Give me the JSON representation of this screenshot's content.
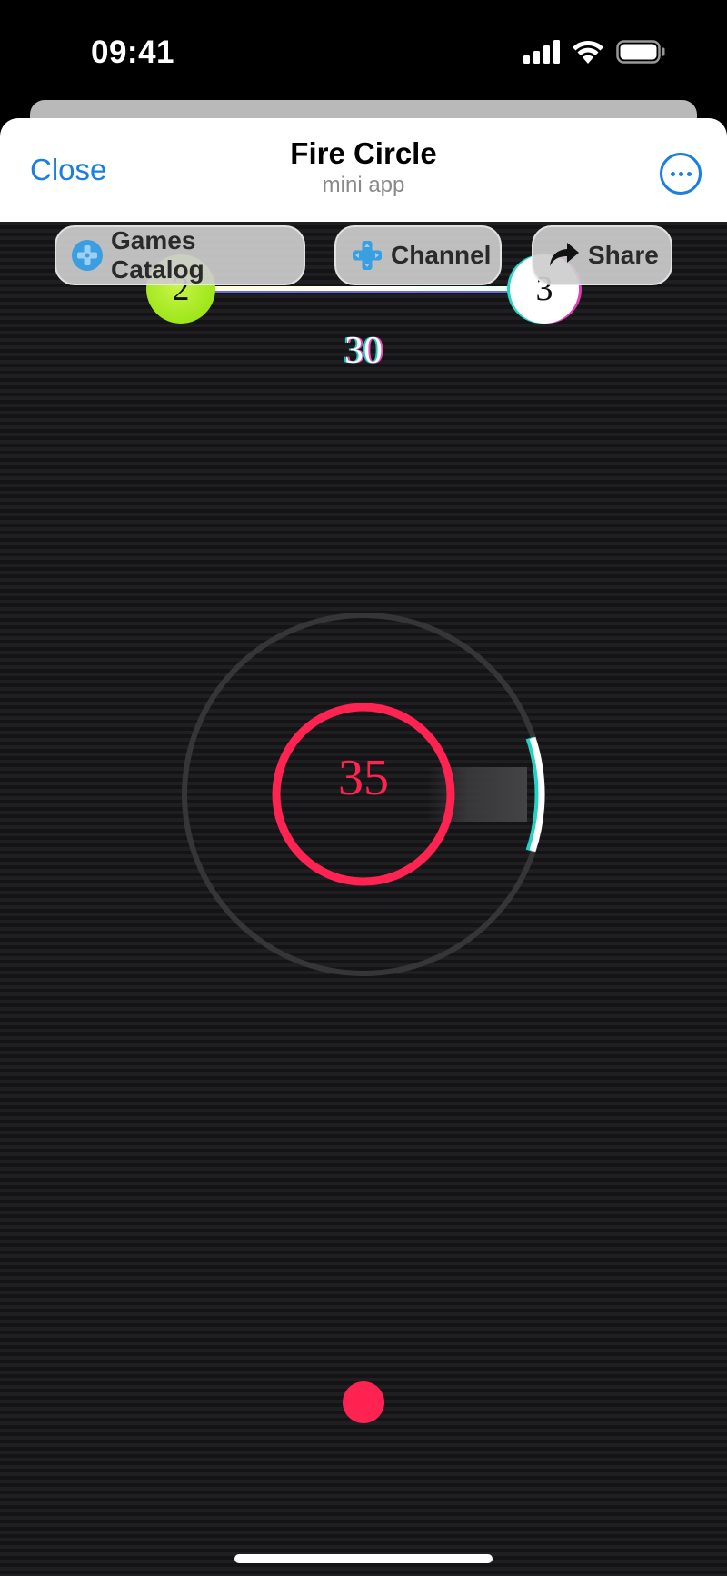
{
  "status_bar": {
    "time": "09:41",
    "icons": [
      "signal-icon",
      "wifi-icon",
      "battery-icon"
    ]
  },
  "header": {
    "close_label": "Close",
    "title": "Fire Circle",
    "subtitle": "mini app",
    "more_icon": "more-icon"
  },
  "toolbar": {
    "games_catalog_label": "Games Catalog",
    "channel_label": "Channel",
    "share_label": "Share"
  },
  "game": {
    "current_level": "2",
    "next_level": "3",
    "hit_count": "30",
    "score": "35"
  },
  "colors": {
    "accent_blue": "#1b7fe0",
    "target_red": "#ff2352",
    "level_green": "#9fe61a",
    "background": "#1d1d1f"
  }
}
